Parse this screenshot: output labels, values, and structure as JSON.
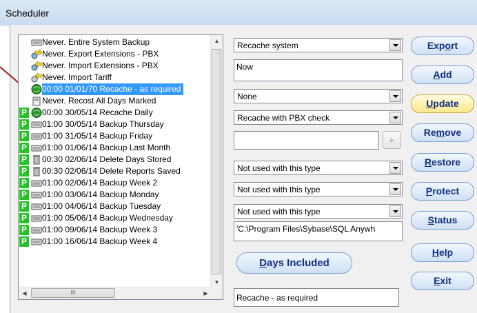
{
  "window": {
    "title": "Scheduler"
  },
  "schedule_list": {
    "items": [
      {
        "flag": "",
        "icon": "backup-drive-icon",
        "text": "Never.  Entire System Backup",
        "selected": false
      },
      {
        "flag": "",
        "icon": "extension-export-icon",
        "text": "Never.  Export Extensions - PBX",
        "selected": false
      },
      {
        "flag": "",
        "icon": "extension-import-icon",
        "text": "Never.  Import Extensions - PBX",
        "selected": false
      },
      {
        "flag": "",
        "icon": "tariff-import-icon",
        "text": "Never.  Import Tariff",
        "selected": false
      },
      {
        "flag": "",
        "icon": "recache-globe-icon",
        "text": "00:00 01/01/70 Recache - as required",
        "selected": true
      },
      {
        "flag": "",
        "icon": "recost-icon",
        "text": "Never.  Recost All Days Marked",
        "selected": false
      },
      {
        "flag": "P",
        "icon": "recache-globe-icon",
        "text": "00:00 30/05/14 Recache Daily",
        "selected": false
      },
      {
        "flag": "P",
        "icon": "backup-drive-icon",
        "text": "01:00 30/05/14 Backup Thursday",
        "selected": false
      },
      {
        "flag": "P",
        "icon": "backup-drive-icon",
        "text": "01:00 31/05/14 Backup Friday",
        "selected": false
      },
      {
        "flag": "P",
        "icon": "backup-drive-icon",
        "text": "01:00 01/06/14 Backup Last Month",
        "selected": false
      },
      {
        "flag": "P",
        "icon": "delete-icon",
        "text": "00:30 02/06/14 Delete Days Stored",
        "selected": false
      },
      {
        "flag": "P",
        "icon": "delete-icon",
        "text": "00:30 02/06/14 Delete Reports Saved",
        "selected": false
      },
      {
        "flag": "P",
        "icon": "backup-drive-icon",
        "text": "01:00 02/06/14 Backup Week 2",
        "selected": false
      },
      {
        "flag": "P",
        "icon": "backup-drive-icon",
        "text": "01:00 03/06/14 Backup Monday",
        "selected": false
      },
      {
        "flag": "P",
        "icon": "backup-drive-icon",
        "text": "01:00 04/06/14 Backup Tuesday",
        "selected": false
      },
      {
        "flag": "P",
        "icon": "backup-drive-icon",
        "text": "01:00 05/06/14 Backup Wednesday",
        "selected": false
      },
      {
        "flag": "P",
        "icon": "backup-drive-icon",
        "text": "01:00 09/06/14 Backup Week 3",
        "selected": false
      },
      {
        "flag": "P",
        "icon": "backup-drive-icon",
        "text": "01:00 16/06/14 Backup Week 4",
        "selected": false
      }
    ],
    "hscroll_grip": "III"
  },
  "form": {
    "task_type": "Recache system",
    "when": "Now",
    "frequency": "None",
    "recache_mode": "Recache with PBX check",
    "number_field": "",
    "plus_label": "+",
    "option1": "Not used with this type",
    "option2": "Not used with this type",
    "option3": "Not used with this type",
    "path": "'C:\\Program Files\\Sybase\\SQL Anywh",
    "days_included_label": "Days Included",
    "description": "Recache - as required"
  },
  "buttons": {
    "export": "Export",
    "add": "Add",
    "update": "Update",
    "remove": "Remove",
    "restore": "Restore",
    "protect": "Protect",
    "status": "Status",
    "help": "Help",
    "exit": "Exit"
  },
  "colors": {
    "selection": "#3399ff",
    "protect_flag": "#22c322",
    "button_text": "#10307f",
    "highlight_button": "#fde98a",
    "annotation_arrow": "#a0302a"
  }
}
